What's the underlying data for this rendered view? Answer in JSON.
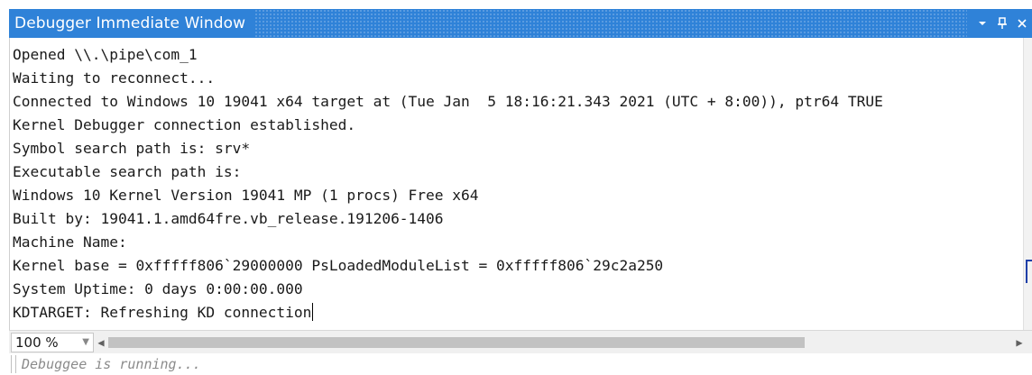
{
  "window": {
    "title": "Debugger Immediate Window",
    "controls": {
      "dropdown_icon": "chevron-down-icon",
      "pin_icon": "pin-icon",
      "close_icon": "close-icon"
    }
  },
  "output": {
    "lines": [
      "Opened \\\\.\\pipe\\com_1",
      "Waiting to reconnect...",
      "Connected to Windows 10 19041 x64 target at (Tue Jan  5 18:16:21.343 2021 (UTC + 8:00)), ptr64 TRUE",
      "Kernel Debugger connection established.",
      "Symbol search path is: srv*",
      "Executable search path is:",
      "Windows 10 Kernel Version 19041 MP (1 procs) Free x64",
      "Built by: 19041.1.amd64fre.vb_release.191206-1406",
      "Machine Name:",
      "Kernel base = 0xfffff806`29000000 PsLoadedModuleList = 0xfffff806`29c2a250",
      "System Uptime: 0 days 0:00:00.000",
      "KDTARGET: Refreshing KD connection"
    ]
  },
  "zoom": {
    "value": "100 %"
  },
  "scroll": {
    "horizontal_thumb_fraction": 0.77
  },
  "status": {
    "text": "Debuggee is running..."
  },
  "colors": {
    "titlebar": "#2f82d8",
    "text": "#1a1a1a",
    "status_text": "#8a8a8a"
  }
}
